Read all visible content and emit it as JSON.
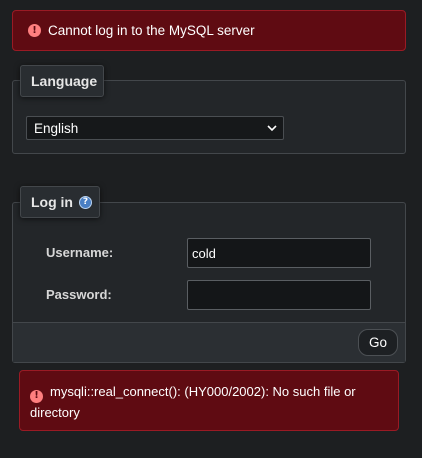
{
  "top_error": {
    "icon": "error-icon",
    "text": "Cannot log in to the MySQL server"
  },
  "language": {
    "legend": "Language",
    "selected": "English"
  },
  "login": {
    "legend": "Log in",
    "help_icon": "help-icon",
    "username_label": "Username:",
    "username_value": "cold",
    "password_label": "Password:",
    "password_value": "",
    "go_label": "Go"
  },
  "bottom_error": {
    "icon": "error-icon",
    "text": "mysqli::real_connect(): (HY000/2002): No such file or directory"
  },
  "colors": {
    "background": "#1d1f21",
    "error_bg": "#5f0b12",
    "error_border": "#9a1a24"
  }
}
